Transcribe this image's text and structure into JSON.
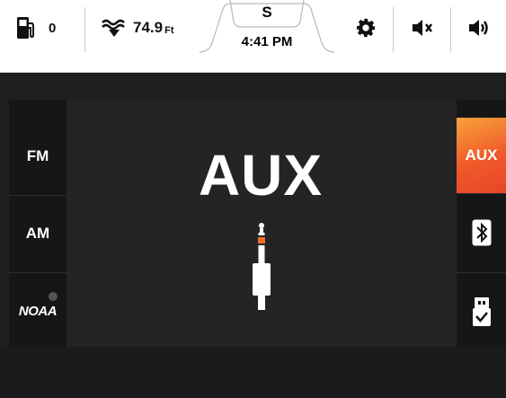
{
  "topbar": {
    "fuel_value": "0",
    "depth_value": "74.9",
    "depth_unit": "Ft",
    "heading": "S",
    "time": "4:41 PM"
  },
  "sources_left": [
    {
      "label": "FM"
    },
    {
      "label": "AM"
    },
    {
      "label": "NOAA"
    }
  ],
  "sources_right": [
    {
      "label": "AUX"
    },
    {
      "icon": "bluetooth-icon"
    },
    {
      "icon": "usb-icon"
    }
  ],
  "main": {
    "title": "AUX",
    "icon": "aux-jack-icon"
  },
  "colors": {
    "accent_start": "#f7a23b",
    "accent_end": "#e8452a",
    "panel": "#242424",
    "rail": "#161616"
  }
}
